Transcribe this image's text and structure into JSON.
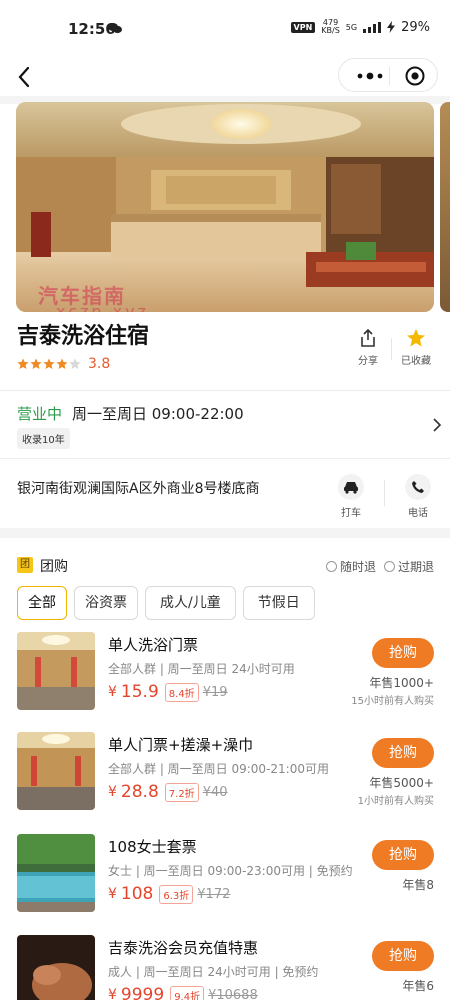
{
  "status_bar": {
    "time": "12:56",
    "vpn": "VPN",
    "speed_top": "479",
    "speed_bottom": "KB/S",
    "network": "5G",
    "battery": "29%"
  },
  "business": {
    "name": "吉泰洗浴住宿",
    "rating": "3.8",
    "stars_filled": 4,
    "share_label": "分享",
    "fav_label": "已收藏",
    "status": "营业中",
    "hours": "周一至周日 09:00-22:00",
    "tag": "收录10年",
    "address": "银河南街观澜国际A区外商业8号楼底商",
    "taxi_label": "打车",
    "phone_label": "电话",
    "watermark_line1": "汽车指南",
    "watermark_line2": "xczn.xyz"
  },
  "group_buy": {
    "icon_text": "团",
    "title": "团购",
    "refund_any": "随时退",
    "refund_expired": "过期退",
    "filters": [
      {
        "label": "全部",
        "active": true
      },
      {
        "label": "浴资票",
        "active": false
      },
      {
        "label": "成人/儿童",
        "active": false
      },
      {
        "label": "节假日",
        "active": false
      }
    ],
    "deals": [
      {
        "name": "单人洗浴门票",
        "sub": "全部人群 | 周一至周日 24小时可用",
        "currency": "¥",
        "price": "15.9",
        "discount": "8.4折",
        "orig": "¥19",
        "buy": "抢购",
        "sold": "年售1000+",
        "recent": "15小时前有人购买"
      },
      {
        "name": "单人门票+搓澡+澡巾",
        "sub": "全部人群 | 周一至周日 09:00-21:00可用",
        "currency": "¥",
        "price": "28.8",
        "discount": "7.2折",
        "orig": "¥40",
        "buy": "抢购",
        "sold": "年售5000+",
        "recent": "1小时前有人购买"
      },
      {
        "name": "108女士套票",
        "sub": "女士 | 周一至周日 09:00-23:00可用 | 免预约",
        "currency": "¥",
        "price": "108",
        "discount": "6.3折",
        "orig": "¥172",
        "buy": "抢购",
        "sold": "年售8",
        "recent": ""
      },
      {
        "name": "吉泰洗浴会员充值特惠",
        "sub": "成人 | 周一至周日 24小时可用 | 免预约",
        "currency": "¥",
        "price": "9999",
        "discount": "9.4折",
        "orig": "¥10688",
        "buy": "抢购",
        "sold": "年售6",
        "recent": ""
      }
    ]
  }
}
